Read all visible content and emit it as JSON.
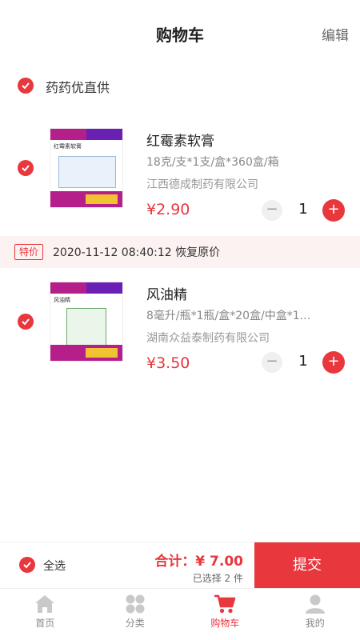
{
  "header": {
    "title": "购物车",
    "edit_label": "编辑"
  },
  "store": {
    "name": "药药优直供",
    "checked": true
  },
  "items": [
    {
      "name": "红霉素软膏",
      "spec": "18克/支*1支/盒*360盒/箱",
      "maker": "江西德成制药有限公司",
      "price": "¥2.90",
      "quantity": "1",
      "checked": true,
      "thumb_title": "红霉素软膏"
    },
    {
      "name": "风油精",
      "spec": "8毫升/瓶*1瓶/盒*20盒/中盒*1...",
      "maker": "湖南众益泰制药有限公司",
      "price": "¥3.50",
      "quantity": "1",
      "checked": true,
      "thumb_title": "风油精"
    }
  ],
  "promo": {
    "tag": "特价",
    "text": "2020-11-12  08:40:12 恢复原价"
  },
  "footer": {
    "select_all_label": "全选",
    "total_text": "合计：¥ 7.00",
    "selected_text": "已选择 2 件",
    "submit_label": "提交"
  },
  "tabbar": [
    {
      "label": "首页",
      "icon": "home-icon",
      "active": false
    },
    {
      "label": "分类",
      "icon": "category-icon",
      "active": false
    },
    {
      "label": "购物车",
      "icon": "cart-icon",
      "active": true
    },
    {
      "label": "我的",
      "icon": "user-icon",
      "active": false
    }
  ],
  "colors": {
    "accent": "#e8373d",
    "promo_bg": "#fdf2f2",
    "text_muted": "#888888"
  }
}
